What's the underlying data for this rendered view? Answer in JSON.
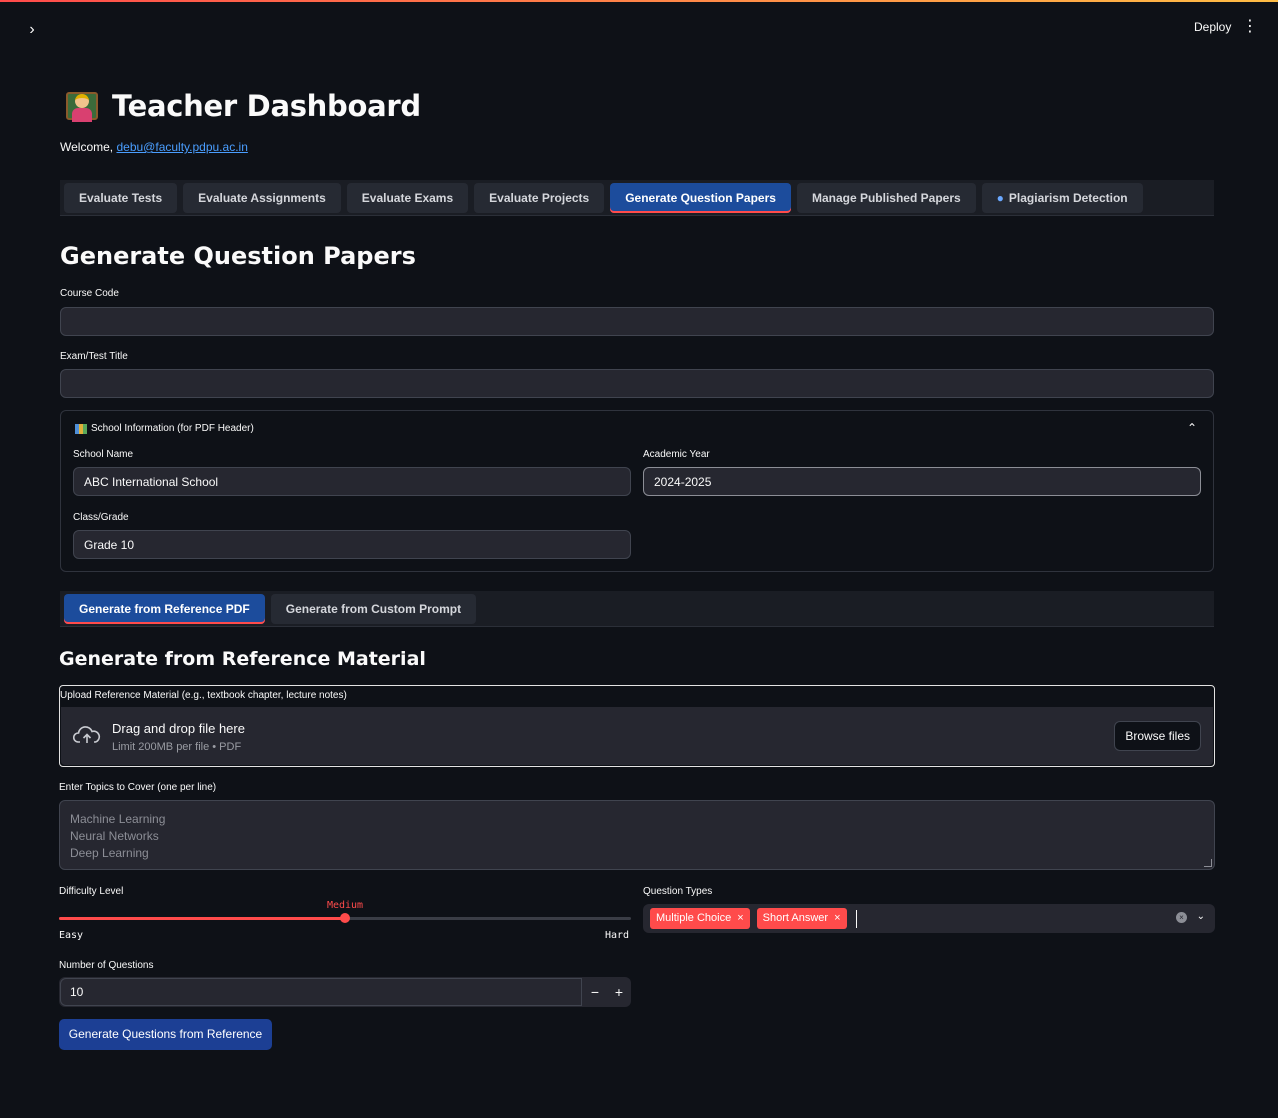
{
  "header": {
    "deploy_label": "Deploy",
    "menu_icon": "kebab-menu-icon",
    "sidebar_toggle_icon": "chevron-right-icon"
  },
  "page": {
    "title": "Teacher Dashboard",
    "title_icon": "teacher-emoji-icon",
    "welcome_prefix": "Welcome,",
    "welcome_email": "debu@faculty.pdpu.ac.in"
  },
  "main_tabs": [
    {
      "label": "Evaluate Tests",
      "active": false
    },
    {
      "label": "Evaluate Assignments",
      "active": false
    },
    {
      "label": "Evaluate Exams",
      "active": false
    },
    {
      "label": "Evaluate Projects",
      "active": false
    },
    {
      "label": "Generate Question Papers",
      "active": true
    },
    {
      "label": "Manage Published Papers",
      "active": false
    },
    {
      "label": "Plagiarism Detection",
      "active": false,
      "icon": "magnifier-icon"
    }
  ],
  "section": {
    "title": "Generate Question Papers",
    "course_code_label": "Course Code",
    "course_code_value": "",
    "exam_title_label": "Exam/Test Title",
    "exam_title_value": ""
  },
  "school_info": {
    "header": "School Information (for PDF Header)",
    "icon": "books-icon",
    "school_name_label": "School Name",
    "school_name_value": "ABC International School",
    "academic_year_label": "Academic Year",
    "academic_year_value": "2024-2025",
    "class_label": "Class/Grade",
    "class_value": "Grade 10"
  },
  "sub_tabs": [
    {
      "label": "Generate from Reference PDF",
      "active": true
    },
    {
      "label": "Generate from Custom Prompt",
      "active": false
    }
  ],
  "reference": {
    "title": "Generate from Reference Material",
    "upload_label": "Upload Reference Material (e.g., textbook chapter, lecture notes)",
    "drop_title": "Drag and drop file here",
    "drop_limit": "Limit 200MB per file • PDF",
    "browse_label": "Browse files",
    "topics_label": "Enter Topics to Cover (one per line)",
    "topics_placeholder": [
      "Machine Learning",
      "Neural Networks",
      "Deep Learning"
    ]
  },
  "difficulty": {
    "label": "Difficulty Level",
    "options": [
      "Easy",
      "Medium",
      "Hard"
    ],
    "value": "Medium",
    "fraction": 0.5,
    "min_label": "Easy",
    "max_label": "Hard"
  },
  "question_types": {
    "label": "Question Types",
    "selected": [
      "Multiple Choice",
      "Short Answer"
    ]
  },
  "num_questions": {
    "label": "Number of Questions",
    "value": "10",
    "minus": "−",
    "plus": "+"
  },
  "submit_label": "Generate Questions from Reference",
  "colors": {
    "background": "#0e1117",
    "accent_red": "#ff4b4b",
    "active_tab": "#1c4c9c",
    "primary_button": "#1c3f94",
    "link": "#4a9eff"
  }
}
